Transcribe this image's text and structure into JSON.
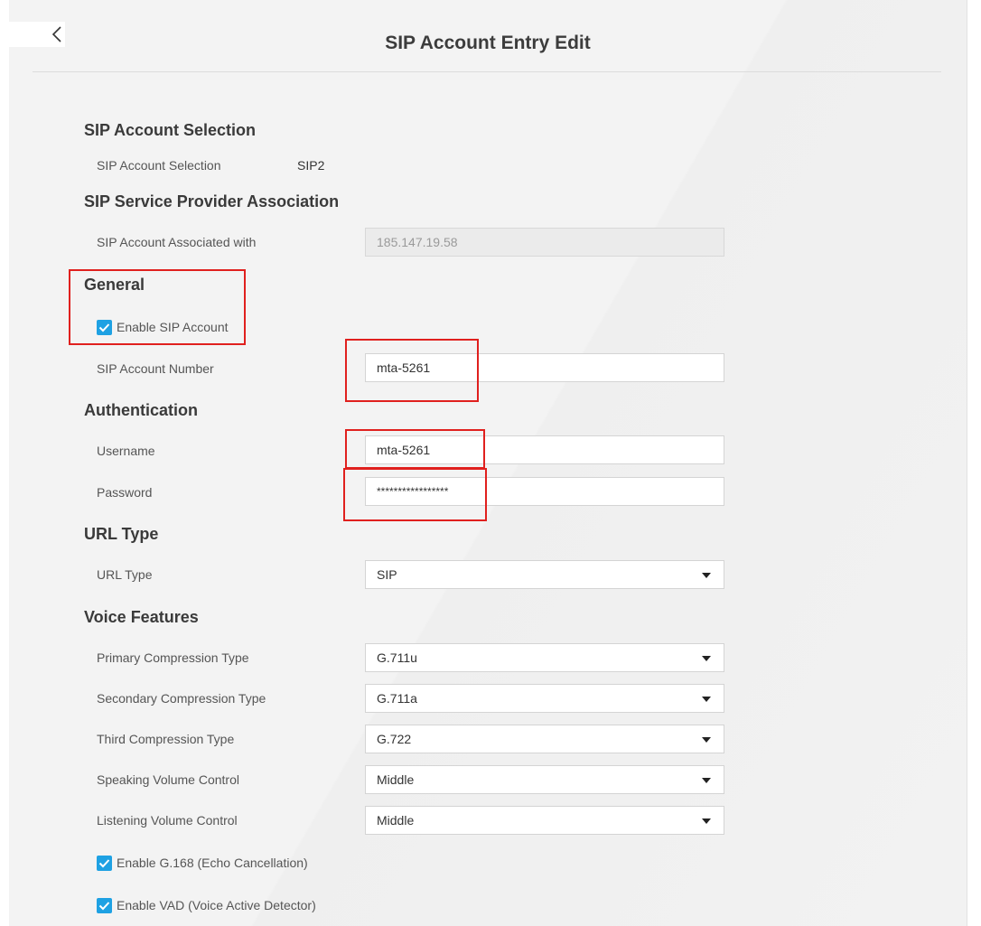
{
  "header": {
    "title": "SIP Account Entry Edit"
  },
  "sections": {
    "selection": {
      "title": "SIP Account Selection",
      "label": "SIP Account Selection",
      "value": "SIP2"
    },
    "provider": {
      "title": "SIP Service Provider Association",
      "label": "SIP Account Associated with",
      "value": "185.147.19.58"
    },
    "general": {
      "title": "General",
      "enable_label": "Enable SIP Account",
      "number_label": "SIP Account Number",
      "number_value": "mta-5261"
    },
    "auth": {
      "title": "Authentication",
      "username_label": "Username",
      "username_value": "mta-5261",
      "password_label": "Password",
      "password_value": "*****************"
    },
    "url": {
      "title": "URL Type",
      "label": "URL Type",
      "value": "SIP"
    },
    "voice": {
      "title": "Voice Features",
      "primary_label": "Primary Compression Type",
      "primary_value": "G.711u",
      "secondary_label": "Secondary Compression Type",
      "secondary_value": "G.711a",
      "third_label": "Third Compression Type",
      "third_value": "G.722",
      "speaking_label": "Speaking Volume Control",
      "speaking_value": "Middle",
      "listening_label": "Listening Volume Control",
      "listening_value": "Middle",
      "echo_label": "Enable G.168 (Echo Cancellation)",
      "vad_label": "Enable VAD (Voice Active Detector)"
    }
  },
  "colors": {
    "accent": "#1ea1e3",
    "annotation": "#e0201e",
    "panel": "#f3f3f3"
  },
  "icons": {
    "back": "chevron-left-icon",
    "check": "checkmark-icon",
    "dropdown": "caret-down-icon"
  }
}
